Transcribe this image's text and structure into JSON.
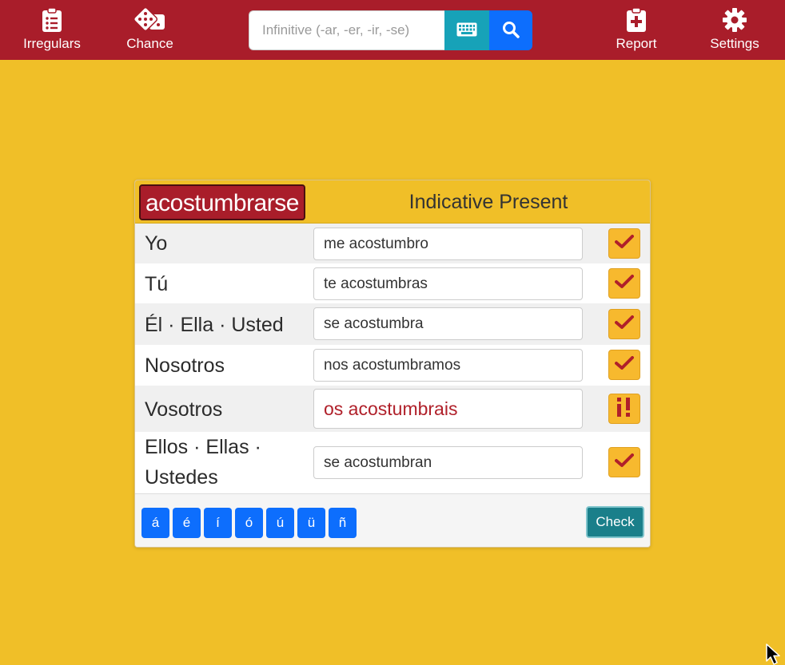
{
  "nav": {
    "irregulars": "Irregulars",
    "chance": "Chance",
    "report": "Report",
    "settings": "Settings",
    "search_placeholder": "Infinitive (-ar, -er, -ir, -se)",
    "icons": {
      "irregulars": "clipboard-list-icon",
      "chance": "dice-icon",
      "keyboard": "keyboard-icon",
      "search": "search-icon",
      "report": "clipboard-plus-icon",
      "settings": "gear-icon"
    }
  },
  "card": {
    "verb": "acostumbrarse",
    "tense": "Indicative Present",
    "rows": [
      {
        "pronoun": "Yo",
        "answer": "me acostumbro",
        "status": "correct"
      },
      {
        "pronoun": "Tú",
        "answer": "te acostumbras",
        "status": "correct"
      },
      {
        "pronoun": "Él · Ella · Usted",
        "answer": "se acostumbra",
        "status": "correct"
      },
      {
        "pronoun": "Nosotros",
        "answer": "nos acostumbramos",
        "status": "correct"
      },
      {
        "pronoun": "Vosotros",
        "answer": "os acostumbrais",
        "status": "incorrect"
      },
      {
        "pronoun": "Ellos · Ellas ·",
        "pronoun_line2": "Ustedes",
        "answer": "se acostumbran",
        "status": "correct"
      }
    ],
    "status_marks": {
      "correct": "checkmark-icon",
      "incorrect": "inverted-exclamation-icon"
    },
    "accent_keys": [
      "á",
      "é",
      "í",
      "ó",
      "ú",
      "ü",
      "ñ"
    ],
    "check_label": "Check"
  },
  "colors": {
    "navbar": "#a91d2a",
    "background": "#f0bf28",
    "primary": "#0d6efd",
    "info": "#17a2b8",
    "status_button": "#f7b92e",
    "mark": "#b0202a",
    "check_button": "#1a7f8a"
  }
}
